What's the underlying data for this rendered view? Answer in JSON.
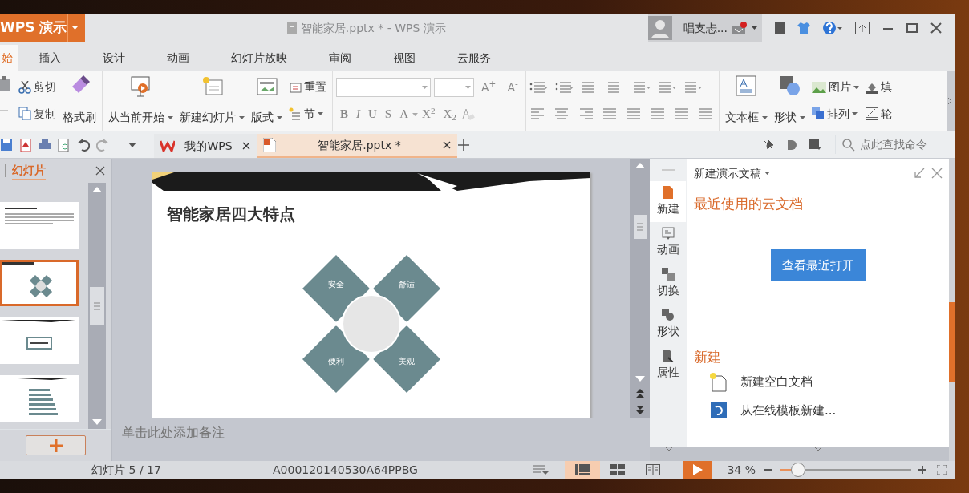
{
  "app_button": {
    "label": "WPS 演示"
  },
  "title": "智能家居.pptx * - WPS 演示",
  "user": {
    "name": "唱支忐...",
    "notification": true
  },
  "menu_tabs": [
    {
      "label": "始",
      "selected": true
    },
    {
      "label": "插入",
      "selected": false
    },
    {
      "label": "设计",
      "selected": false
    },
    {
      "label": "动画",
      "selected": false
    },
    {
      "label": "幻灯片放映",
      "selected": false
    },
    {
      "label": "审阅",
      "selected": false
    },
    {
      "label": "视图",
      "selected": false
    },
    {
      "label": "云服务",
      "selected": false
    }
  ],
  "ribbon": {
    "cut": "剪切",
    "copy": "复制",
    "format_painter": "格式刷",
    "play_from_current": "从当前开始",
    "new_slide": "新建幻灯片",
    "layout": "版式",
    "reset": "重置",
    "section": "节",
    "grow_font": "A$^{+}$",
    "shrink_font": "A$^{-}$",
    "font_styles": [
      "B",
      "I",
      "U",
      "S",
      "A"
    ],
    "superscript": "X$^{2}$",
    "subscript": "X$_{2}$",
    "text_box": "文本框",
    "shape": "形状",
    "picture": "图片",
    "arrange": "排列",
    "fill": "填",
    "outline": "轮"
  },
  "doc_tabs": [
    {
      "label": "我的WPS",
      "kind": "home",
      "selected": false
    },
    {
      "label": "智能家居.pptx *",
      "kind": "document",
      "selected": true
    }
  ],
  "command_search": {
    "placeholder": "点此查找命令"
  },
  "slides_pane": {
    "tab": "幻灯片",
    "thumbnails": [
      {
        "kind": "text",
        "selected": false
      },
      {
        "kind": "diagram",
        "selected": true
      },
      {
        "kind": "title",
        "selected": false
      },
      {
        "kind": "chart",
        "selected": false
      }
    ]
  },
  "slide": {
    "title": "智能家居四大特点",
    "features": [
      "安全",
      "舒适",
      "便利",
      "美观"
    ]
  },
  "notes": {
    "placeholder": "单击此处添加备注"
  },
  "task_pane": {
    "title": "新建演示文稿",
    "side_items": [
      {
        "label": "新建",
        "kind": "new",
        "selected": true
      },
      {
        "label": "动画",
        "kind": "animation",
        "selected": false
      },
      {
        "label": "切换",
        "kind": "transition",
        "selected": false
      },
      {
        "label": "形状",
        "kind": "shape",
        "selected": false
      },
      {
        "label": "属性",
        "kind": "property",
        "selected": false
      }
    ],
    "recent_heading": "最近使用的云文档",
    "recent_button": "查看最近打开",
    "new_heading": "新建",
    "new_items": [
      {
        "label": "新建空白文档",
        "kind": "blank"
      },
      {
        "label": "从在线模板新建...",
        "kind": "template"
      }
    ]
  },
  "status_bar": {
    "slide_counter": "幻灯片 5 / 17",
    "template_id": "A000120140530A64PPBG",
    "views": [
      {
        "kind": "normal",
        "selected": true
      },
      {
        "kind": "sorter",
        "selected": false
      },
      {
        "kind": "reading",
        "selected": false
      }
    ],
    "zoom": "34 %",
    "zoom_slider": {
      "level": 0.14
    }
  }
}
